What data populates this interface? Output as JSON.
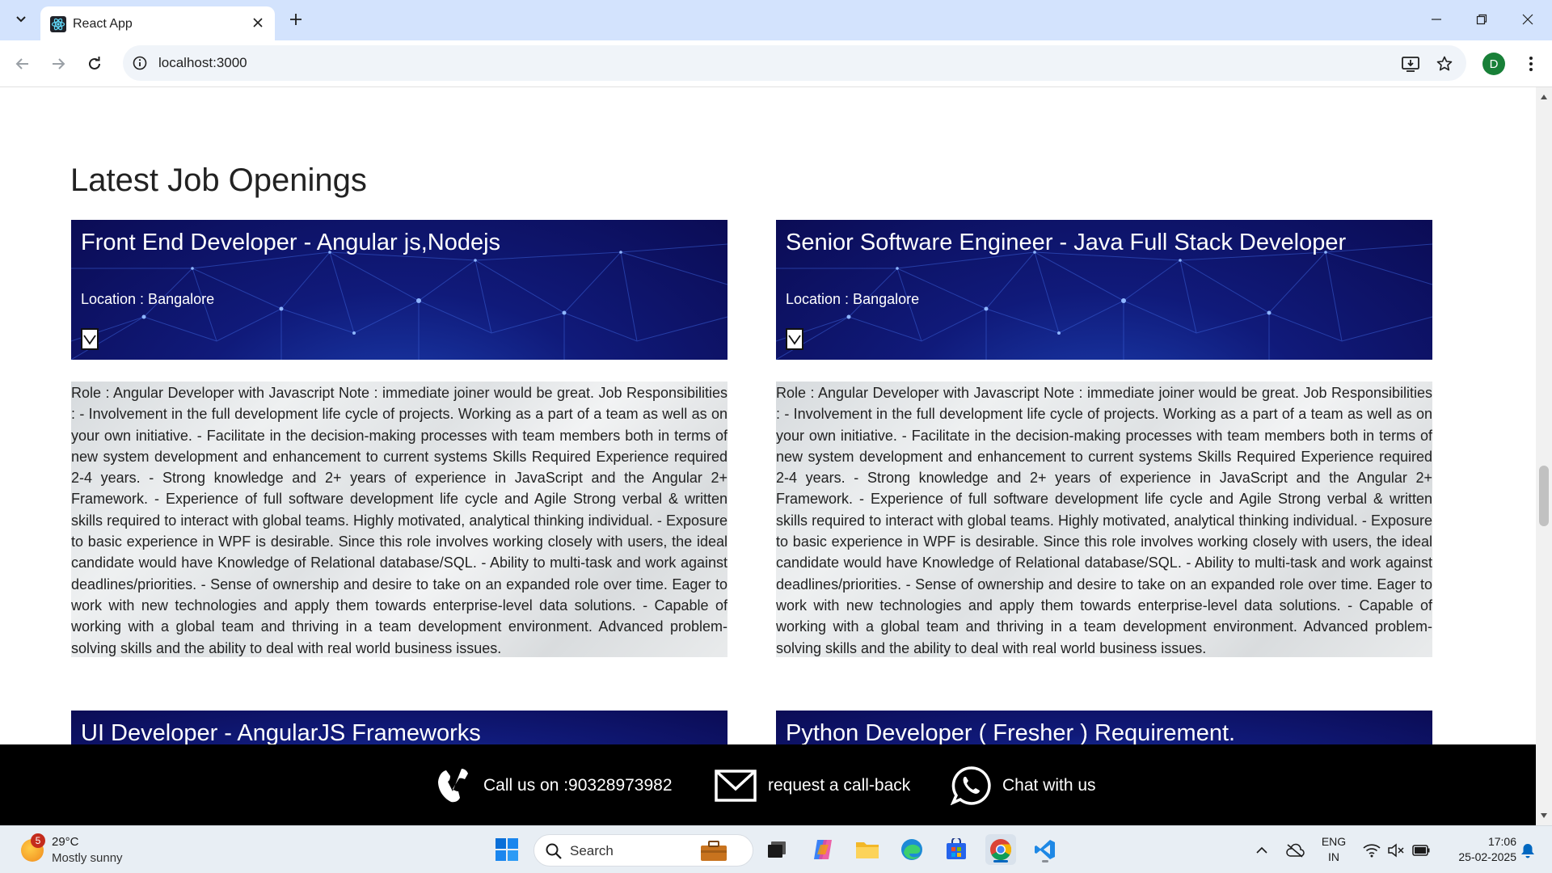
{
  "browser": {
    "tab_title": "React App",
    "url": "localhost:3000",
    "profile_initial": "D",
    "accent": "#d3e3fd"
  },
  "page": {
    "section_title": "Latest Job Openings",
    "jobs": [
      {
        "title": "Front End Developer - Angular js,Nodejs",
        "location": "Location : Bangalore",
        "toggle_icon": "chevron-down-icon",
        "description": "Role : Angular Developer with Javascript Note : immediate joiner would be great. Job Responsibilities : - Involvement in the full development life cycle of projects. Working as a part of a team as well as on your own initiative. - Facilitate in the decision-making processes with team members both in terms of new system development and enhancement to current systems Skills Required Experience required 2-4 years. - Strong knowledge and 2+ years of experience in JavaScript and the Angular 2+ Framework. - Experience of full software development life cycle and Agile Strong verbal & written skills required to interact with global teams. Highly motivated, analytical thinking individual. - Exposure to basic experience in WPF is desirable. Since this role involves working closely with users, the ideal candidate would have Knowledge of Relational database/SQL. - Ability to multi-task and work against deadlines/priorities. - Sense of ownership and desire to take on an expanded role over time. Eager to work with new technologies and apply them towards enterprise-level data solutions. - Capable of working with a global team and thriving in a team development environment. Advanced problem-solving skills and the ability to deal with real world business issues."
      },
      {
        "title": "Senior Software Engineer - Java Full Stack Developer",
        "location": "Location : Bangalore",
        "toggle_icon": "chevron-down-icon",
        "description": "Role : Angular Developer with Javascript Note : immediate joiner would be great. Job Responsibilities : - Involvement in the full development life cycle of projects. Working as a part of a team as well as on your own initiative. - Facilitate in the decision-making processes with team members both in terms of new system development and enhancement to current systems Skills Required Experience required 2-4 years. - Strong knowledge and 2+ years of experience in JavaScript and the Angular 2+ Framework. - Experience of full software development life cycle and Agile Strong verbal & written skills required to interact with global teams. Highly motivated, analytical thinking individual. - Exposure to basic experience in WPF is desirable. Since this role involves working closely with users, the ideal candidate would have Knowledge of Relational database/SQL. - Ability to multi-task and work against deadlines/priorities. - Sense of ownership and desire to take on an expanded role over time. Eager to work with new technologies and apply them towards enterprise-level data solutions. - Capable of working with a global team and thriving in a team development environment. Advanced problem-solving skills and the ability to deal with real world business issues."
      },
      {
        "title": "UI Developer - AngularJS Frameworks"
      },
      {
        "title": "Python Developer ( Fresher ) Requirement."
      }
    ]
  },
  "contact_bar": {
    "call": "Call us on :90328973982",
    "callback": "request a call-back",
    "chat": "Chat with us"
  },
  "taskbar": {
    "weather_temp": "29°C",
    "weather_desc": "Mostly sunny",
    "weather_badge": "5",
    "search_placeholder": "Search",
    "lang_line1": "ENG",
    "lang_line2": "IN",
    "time": "17:06",
    "date": "25-02-2025"
  }
}
